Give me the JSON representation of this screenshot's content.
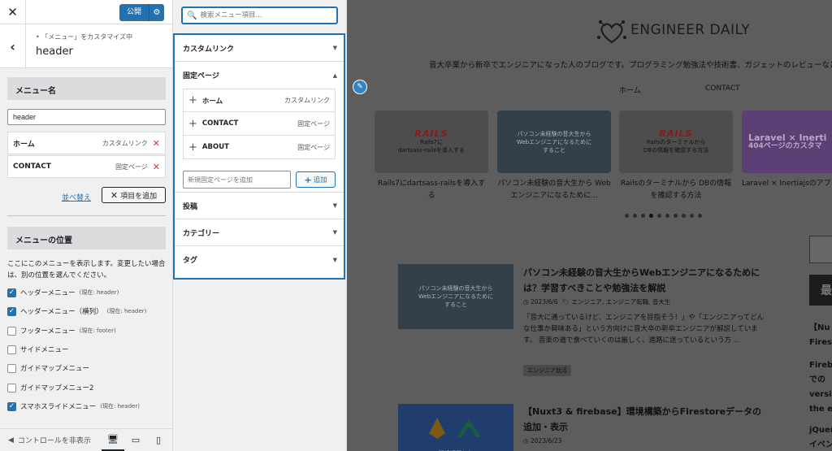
{
  "customizer": {
    "publish_label": "公開",
    "breadcrumb": "「メニュー」をカスタマイズ中",
    "title": "header",
    "menu_name_heading": "メニュー名",
    "menu_name_value": "header",
    "menu_items": [
      {
        "name": "ホーム",
        "type": "カスタムリンク"
      },
      {
        "name": "CONTACT",
        "type": "固定ページ"
      }
    ],
    "reorder_label": "並べ替え",
    "add_item_label": "項目を追加",
    "location_heading": "メニューの位置",
    "location_description": "ここにこのメニューを表示します。変更したい場合は、別の位置を選んでください。",
    "locations": [
      {
        "label": "ヘッダーメニュー",
        "current": "(現在: header)",
        "checked": true
      },
      {
        "label": "ヘッダーメニュー（横列）",
        "current": "(現在: header)",
        "checked": true
      },
      {
        "label": "フッターメニュー",
        "current": "(現在: footer)",
        "checked": false
      },
      {
        "label": "サイドメニュー",
        "current": "",
        "checked": false
      },
      {
        "label": "ガイドマップメニュー",
        "current": "",
        "checked": false
      },
      {
        "label": "ガイドマップメニュー2",
        "current": "",
        "checked": false
      },
      {
        "label": "スマホスライドメニュー",
        "current": "(現在: header)",
        "checked": true
      }
    ],
    "collapse_label": "コントロールを非表示"
  },
  "available_items": {
    "search_placeholder": "検索メニュー項目...",
    "sections": {
      "custom_link": "カスタムリンク",
      "pages": "固定ページ",
      "posts": "投稿",
      "categories": "カテゴリー",
      "tags": "タグ"
    },
    "pages": [
      {
        "name": "ホーム",
        "type": "カスタムリンク"
      },
      {
        "name": "CONTACT",
        "type": "固定ページ"
      },
      {
        "name": "ABOUT",
        "type": "固定ページ"
      }
    ],
    "new_page_placeholder": "新規固定ページを追加",
    "add_label": "追加"
  },
  "preview": {
    "site_title": "ENGINEER DAILY",
    "tagline": "音大卒業から新卒でエンジニアになった人のブログです。プログラミング勉強法や技術書、ガジェットのレビューなどを",
    "nav": [
      "ホーム",
      "CONTACT"
    ],
    "cards": [
      {
        "thumb_logo": "RAILS",
        "thumb_text": "Rails7に\ndartsass-railsを導入する",
        "caption": "Rails7にdartsass-railsを導入する"
      },
      {
        "thumb_logo": "",
        "thumb_text": "パソコン未経験の音大生から\nWebエンジニアになるために\nすること",
        "caption": "パソコン未経験の音大生から Webエンジニアになるために..."
      },
      {
        "thumb_logo": "RAILS",
        "thumb_text": "Railsのターミナルから\nDBの情報を確認する方法",
        "caption": "Railsのターミナルから DBの情報を確認する方法"
      },
      {
        "thumb_logo": "Laravel × Inerti",
        "thumb_text": "404ページのカスタマ",
        "caption": "Laravel × Inertiajsのアプ ーショ..."
      }
    ],
    "slider_dots": 10,
    "slider_active": 3,
    "post1": {
      "image_text": "パソコン未経験の音大生から\nWebエンジニアになるために\nすること",
      "title": "パソコン未経験の音大生からWebエンジニアになるためには？学習すべきことや勉強法を解説",
      "date": "2023/6/6",
      "categories": "エンジニア, エンジニア転職, 音大生",
      "excerpt": "「音大に通っているけど、エンジニアを目指そう！」や「エンジニアってどんな仕事か興味ある」という方向けに音大卒の新卒エンジニアが解説しています。 音楽の道で食べていくのは厳しく、進路に迷っているという方 ...",
      "tag": "エンジニア就活"
    },
    "post2": {
      "image_text": "環境構築から",
      "title": "【Nuxt3 & firebase】環境構築からFirestoreデータの追加・表示",
      "date": "2023/6/23"
    },
    "sidebar_box_text": "最",
    "sidebar_lines": [
      "【Nu",
      "Fires",
      "Fireb",
      "での",
      "versi",
      "the e",
      "jQuer",
      "イベン"
    ]
  }
}
